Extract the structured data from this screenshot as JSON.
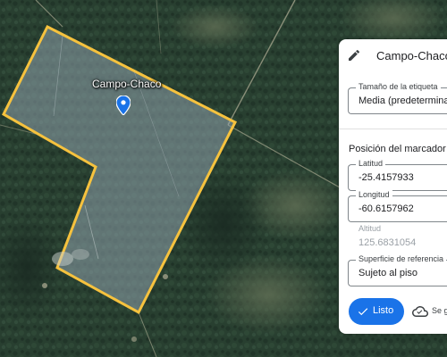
{
  "map": {
    "placemark_label": "Campo-Chaco",
    "polygon_color": "#f6c23e"
  },
  "panel": {
    "title": "Campo-Chaco",
    "label_size": {
      "label": "Tamaño de la etiqueta",
      "value": "Media (predeterminada)"
    },
    "marker_section_title": "Posición del marcador",
    "latitude": {
      "label": "Latitud",
      "value": "-25.4157933"
    },
    "longitude": {
      "label": "Longitud",
      "value": "-60.6157962"
    },
    "altitude": {
      "label": "Altitud",
      "value": "125.6831054"
    },
    "reference_surface": {
      "label": "Superficie de referencia",
      "value": "Sujeto al piso"
    },
    "done_label": "Listo",
    "save_status": "Se g",
    "accent_color": "#1a73e8"
  }
}
